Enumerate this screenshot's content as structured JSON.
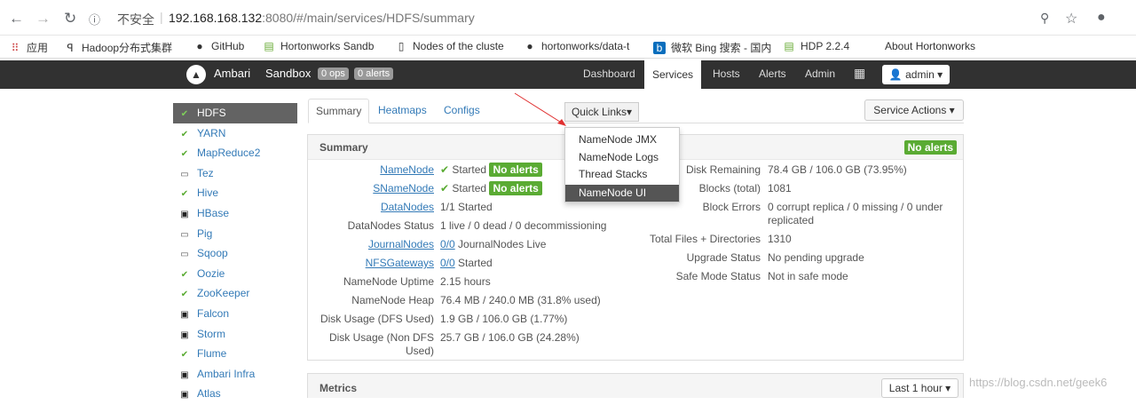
{
  "browser": {
    "insecure_label": "不安全",
    "url_host": "192.168.168.132",
    "url_rest": ":8080/#/main/services/HDFS/summary"
  },
  "bookmarks": [
    {
      "icon": "apps-icon",
      "label": "应用"
    },
    {
      "icon": "bookmark-icon",
      "label": "Hadoop分布式集群"
    },
    {
      "icon": "github-icon",
      "label": "GitHub"
    },
    {
      "icon": "bookmark-icon",
      "label": "Hortonworks Sandb"
    },
    {
      "icon": "page-icon",
      "label": "Nodes of the cluste"
    },
    {
      "icon": "github-icon",
      "label": "hortonworks/data-t"
    },
    {
      "icon": "bing-icon",
      "label": "微软 Bing 搜索 - 国内"
    },
    {
      "icon": "bookmark-icon",
      "label": "HDP 2.2.4"
    },
    {
      "icon": "",
      "label": "About Hortonworks"
    }
  ],
  "topnav": {
    "app_name": "Ambari",
    "cluster_name": "Sandbox",
    "ops_badge": "0 ops",
    "alerts_badge": "0 alerts",
    "items": [
      "Dashboard",
      "Services",
      "Hosts",
      "Alerts",
      "Admin"
    ],
    "active_item": "Services",
    "admin_label": "admin"
  },
  "sidebar": {
    "items": [
      {
        "label": "HDFS",
        "icon": "check-icon",
        "active": true
      },
      {
        "label": "YARN",
        "icon": "check-icon"
      },
      {
        "label": "MapReduce2",
        "icon": "check-icon"
      },
      {
        "label": "Tez",
        "icon": "laptop-icon"
      },
      {
        "label": "Hive",
        "icon": "check-icon"
      },
      {
        "label": "HBase",
        "icon": "maintenance-icon"
      },
      {
        "label": "Pig",
        "icon": "laptop-icon"
      },
      {
        "label": "Sqoop",
        "icon": "laptop-icon"
      },
      {
        "label": "Oozie",
        "icon": "check-icon"
      },
      {
        "label": "ZooKeeper",
        "icon": "check-icon"
      },
      {
        "label": "Falcon",
        "icon": "maintenance-icon"
      },
      {
        "label": "Storm",
        "icon": "maintenance-icon"
      },
      {
        "label": "Flume",
        "icon": "check-icon"
      },
      {
        "label": "Ambari Infra",
        "icon": "maintenance-icon"
      },
      {
        "label": "Atlas",
        "icon": "maintenance-icon"
      }
    ]
  },
  "tabs": {
    "items": [
      "Summary",
      "Heatmaps",
      "Configs"
    ],
    "active": "Summary",
    "quick_links_label": "Quick Links",
    "service_actions_label": "Service Actions"
  },
  "quick_links": {
    "items": [
      "NameNode JMX",
      "NameNode Logs",
      "Thread Stacks",
      "NameNode UI"
    ],
    "selected": "NameNode UI"
  },
  "summary": {
    "title": "Summary",
    "no_alerts": "No alerts",
    "left": [
      {
        "label": "NameNode",
        "link": true,
        "status": "Started",
        "badge": "No alerts"
      },
      {
        "label": "SNameNode",
        "link": true,
        "status": "Started",
        "badge": "No alerts"
      },
      {
        "label": "DataNodes",
        "link": true,
        "value": "1/1 Started"
      },
      {
        "label": "DataNodes Status",
        "value": "1 live / 0 dead / 0 decommissioning"
      },
      {
        "label": "JournalNodes",
        "link": true,
        "value_link": "0/0",
        "value": "JournalNodes Live"
      },
      {
        "label": "NFSGateways",
        "link": true,
        "value_link": "0/0",
        "value": "Started"
      },
      {
        "label": "NameNode Uptime",
        "value": "2.15 hours"
      },
      {
        "label": "NameNode Heap",
        "value": "76.4 MB / 240.0 MB (31.8% used)"
      },
      {
        "label": "Disk Usage (DFS Used)",
        "value": "1.9 GB / 106.0 GB (1.77%)"
      },
      {
        "label_line1": "Disk Usage (Non DFS",
        "label_line2": "Used)",
        "value": "25.7 GB / 106.0 GB (24.28%)"
      }
    ],
    "right": [
      {
        "label": "Disk Remaining",
        "value": "78.4 GB / 106.0 GB (73.95%)"
      },
      {
        "label": "Blocks (total)",
        "value": "1081"
      },
      {
        "label": "Block Errors",
        "value_line1": "0 corrupt replica / 0 missing / 0 under",
        "value_line2": "replicated"
      },
      {
        "label": "Total Files + Directories",
        "value": "1310"
      },
      {
        "label": "Upgrade Status",
        "value": "No pending upgrade"
      },
      {
        "label": "Safe Mode Status",
        "value": "Not in safe mode"
      }
    ]
  },
  "metrics": {
    "title": "Metrics",
    "range_label": "Last 1 hour"
  },
  "watermark": "https://blog.csdn.net/geek6",
  "colors": {
    "accent": "#337ab7",
    "ok": "#5aab33",
    "nav": "#313131",
    "arrow": "#e03030"
  }
}
